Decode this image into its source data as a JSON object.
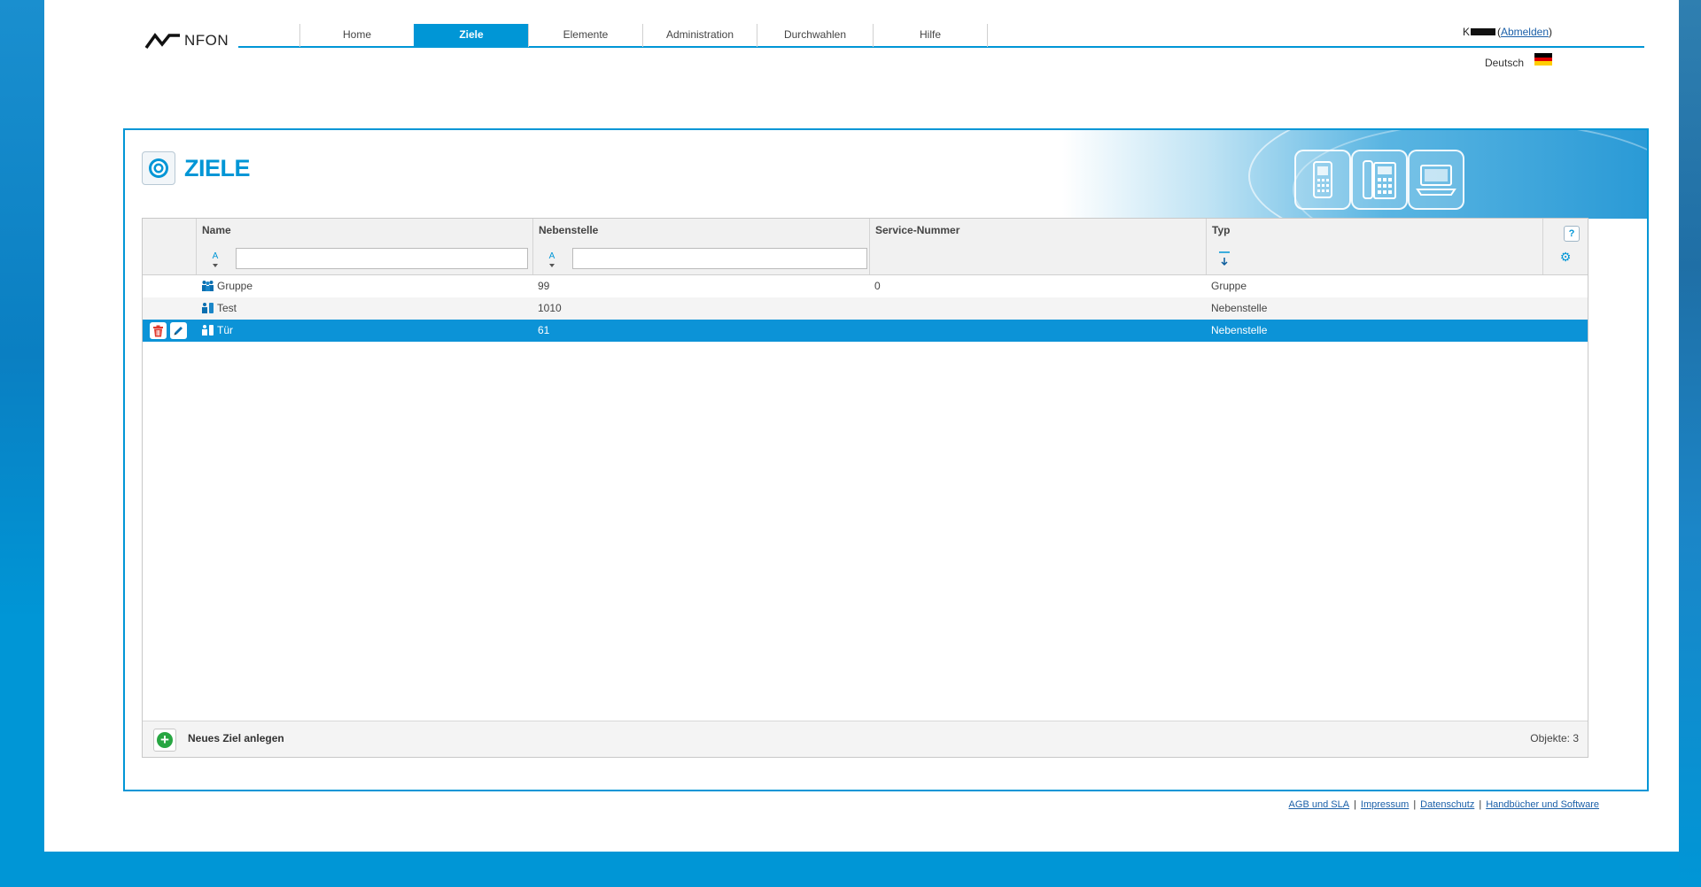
{
  "brand": {
    "logo_text": "NFON"
  },
  "nav": [
    {
      "label": "Home",
      "active": false
    },
    {
      "label": "Ziele",
      "active": true
    },
    {
      "label": "Elemente",
      "active": false
    },
    {
      "label": "Administration",
      "active": false
    },
    {
      "label": "Durchwahlen",
      "active": false
    },
    {
      "label": "Hilfe",
      "active": false
    }
  ],
  "user": {
    "initial": "K",
    "logout_label": "Abmelden"
  },
  "language": {
    "label": "Deutsch",
    "flag_colors": [
      "#000000",
      "#dd0000",
      "#ffce00"
    ]
  },
  "page": {
    "title": "ZIELE"
  },
  "table": {
    "columns": [
      "Name",
      "Nebenstelle",
      "Service-Nummer",
      "Typ"
    ],
    "help_label": "?",
    "filter": {
      "sort_glyph": "A",
      "name_value": "",
      "ext_value": ""
    },
    "rows": [
      {
        "icon": "group-icon",
        "name": "Gruppe",
        "extension": "99",
        "service_number": "0",
        "type": "Gruppe",
        "selected": false
      },
      {
        "icon": "extension-icon",
        "name": "Test",
        "extension": "1010",
        "service_number": "",
        "type": "Nebenstelle",
        "selected": false
      },
      {
        "icon": "extension-icon",
        "name": "Tür",
        "extension": "61",
        "service_number": "",
        "type": "Nebenstelle",
        "selected": true
      }
    ],
    "add_label": "Neues Ziel anlegen",
    "object_count": "Objekte: 3"
  },
  "footer_links": [
    "AGB und SLA",
    "Impressum",
    "Datenschutz",
    "Handbücher und Software"
  ],
  "colors": {
    "accent": "#0096d6",
    "selected_row": "#0c93d7",
    "add_green": "#27a642",
    "delete_red": "#e03a2f"
  }
}
